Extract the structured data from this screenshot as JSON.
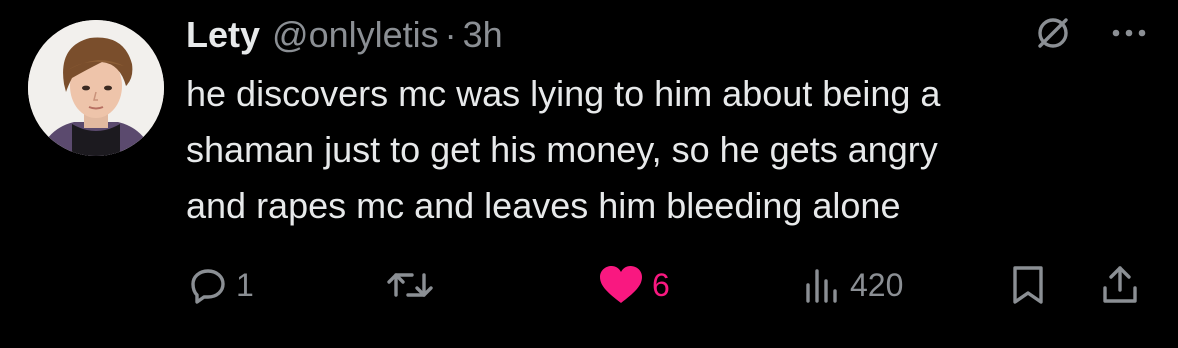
{
  "tweet": {
    "display_name": "Lety",
    "handle": "@onlyletis",
    "separator": "·",
    "time": "3h",
    "text": "he discovers mc was lying to him about being a\nshaman just to get his money, so he gets angry\nand rapes mc and leaves him bleeding alone"
  },
  "actions": {
    "reply_count": "1",
    "retweet_count": "",
    "like_count": "6",
    "view_count": "420"
  },
  "icons": {
    "reply": "reply-icon",
    "retweet": "retweet-icon",
    "like": "heart-icon",
    "views": "views-icon",
    "bookmark": "bookmark-icon",
    "share": "share-icon",
    "grok": "grok-icon",
    "more": "more-icon"
  },
  "colors": {
    "background": "#000000",
    "primary_text": "#e7e9ea",
    "secondary_text": "#8b8f94",
    "like_accent": "#f91880"
  }
}
